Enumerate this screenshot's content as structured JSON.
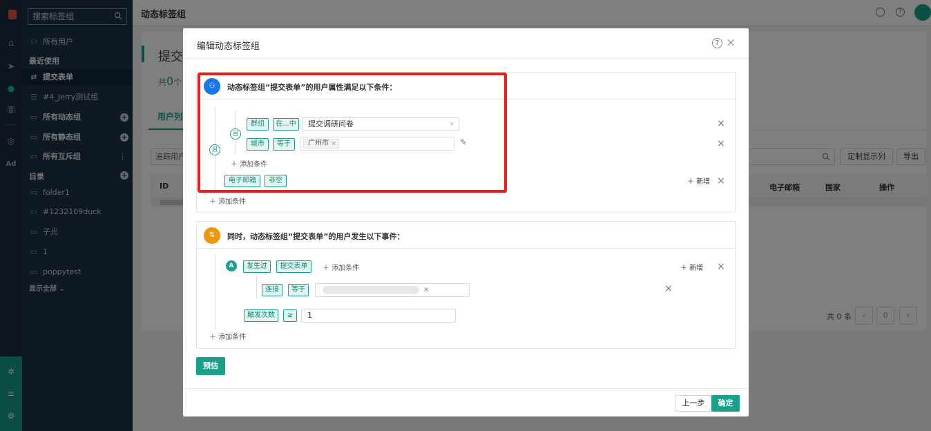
{
  "sidebar": {
    "search_placeholder": "搜索标签组",
    "all_users": "所有用户",
    "recent_heading": "最近使用",
    "recent_items": [
      "提交表单",
      "#4_Jerry测试组"
    ],
    "groups": [
      "所有动态组",
      "所有静态组",
      "所有互斥组"
    ],
    "catalog_heading": "目录",
    "folders": [
      "folder1",
      "#1232109duck",
      "子光",
      "1",
      "poppytest"
    ],
    "show_all": "显示全部"
  },
  "topbar": {
    "title": "动态标签组"
  },
  "background": {
    "page_title": "提交",
    "count_prefix": "共",
    "count_value": "0",
    "count_suffix": "个",
    "tab": "用户列",
    "track_input": "追踪用户",
    "btn_custom_columns": "定制显示列",
    "btn_export": "导出",
    "col_id": "ID",
    "col_email": "电子邮箱",
    "col_country": "国家",
    "col_actions": "操作",
    "total": "共 0 条",
    "page_current": "0"
  },
  "modal": {
    "title": "编辑动态标签组",
    "section1": {
      "heading": "动态标签组“提交表单”的用户属性满足以下条件：",
      "outer_and": "且",
      "inner_and": "且",
      "row1": {
        "attr": "群组",
        "op": "在...中",
        "value": "提交调研问卷"
      },
      "row2": {
        "attr": "城市",
        "op": "等于",
        "chip": "广州市"
      },
      "add_condition_inner": "添加条件",
      "row3": {
        "attr": "电子邮箱",
        "op": "非空"
      },
      "add_new": "新增",
      "add_condition_outer": "添加条件"
    },
    "section2": {
      "heading": "同时，动态标签组“提交表单”的用户发生以下事件：",
      "badge": "A",
      "event": {
        "did": "发生过",
        "event_name": "提交表单",
        "add_condition": "添加条件",
        "add_new": "新增"
      },
      "sub": {
        "attr": "连接",
        "op": "等于"
      },
      "freq": {
        "label": "触发次数",
        "op": "≥",
        "value": "1"
      },
      "add_condition_outer": "添加条件"
    },
    "estimate_button": "预估",
    "prev_button": "上一步",
    "confirm_button": "确定"
  },
  "colors": {
    "accent": "#19a08a",
    "highlight": "#ee1c1c",
    "sidebar_bg": "#1e3347"
  }
}
